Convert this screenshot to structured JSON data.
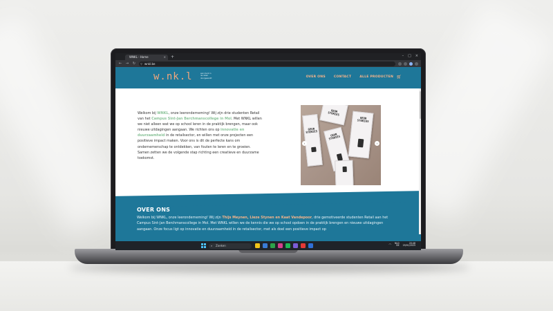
{
  "browser": {
    "tab_title": "WNKL - Home",
    "tab_close": "×",
    "new_tab": "+",
    "url": "wnkl.be",
    "window_controls": [
      "–",
      "□",
      "×"
    ]
  },
  "site": {
    "logo": "w.nk.l",
    "tagline": "een merk in de retail doorgewerkt",
    "menu": [
      "OVER ONS",
      "CONTACT",
      "ALLE PRODUCTEN"
    ],
    "colors": {
      "header": "#1e7799",
      "accent": "#f6b48a",
      "highlight": "#8cc39a"
    }
  },
  "intro": {
    "p1": "Welkom bij ",
    "brand": "WNKL",
    "p2": ", onze leeronderneming! Wij zijn drie studenten Retail van het ",
    "school": "Campus Sint-Jan Berchmanscollege in Mol",
    "p3": ". Met WNKL willen we niet alleen wat we op school leren in de praktijk brengen, maar ook nieuwe uitdagingen aangaan. We richten ons op ",
    "focus": "innovatie en duurzaamheid",
    "p4": " in de retailsector, en willen met onze projecten een positieve impact maken. Voor ons is dit de perfecte kans om ondernemerschap te ontdekken, van fouten te leren en te groeien. Samen zetten we de volgende stap richting een creatieve en duurzame toekomst."
  },
  "carousel": {
    "product_text": "GEUR STORIES",
    "prev": "‹",
    "next": "›"
  },
  "about": {
    "heading": "OVER ONS",
    "p1": "Welkom bij WNKL, onze leeronderneming! Wij zijn ",
    "names": "Thijs Meynen, Lieze Stynen en Kaat Vandepoor",
    "p2": ", drie gemotiveerde studenten Retail aan het Campus Sint-Jan Berchmanscollege in Mol. Met WNKL willen we de kennis die we op school opdoen in de praktijk brengen en nieuwe uitdagingen aangaan. Onze focus ligt op innovatie en duurzaamheid in de retailsector, met als doel een positieve impact op"
  },
  "taskbar": {
    "search_placeholder": "Zoeken",
    "lang": "NLD",
    "lang_sub": "BE",
    "time": "20:46",
    "date": "29/01/2025",
    "app_colors": [
      "#f0c419",
      "#3a7bd5",
      "#2ca24a",
      "#d43f8d",
      "#1db954",
      "#7b5cd6",
      "#e53935",
      "#2f6fd6"
    ]
  }
}
